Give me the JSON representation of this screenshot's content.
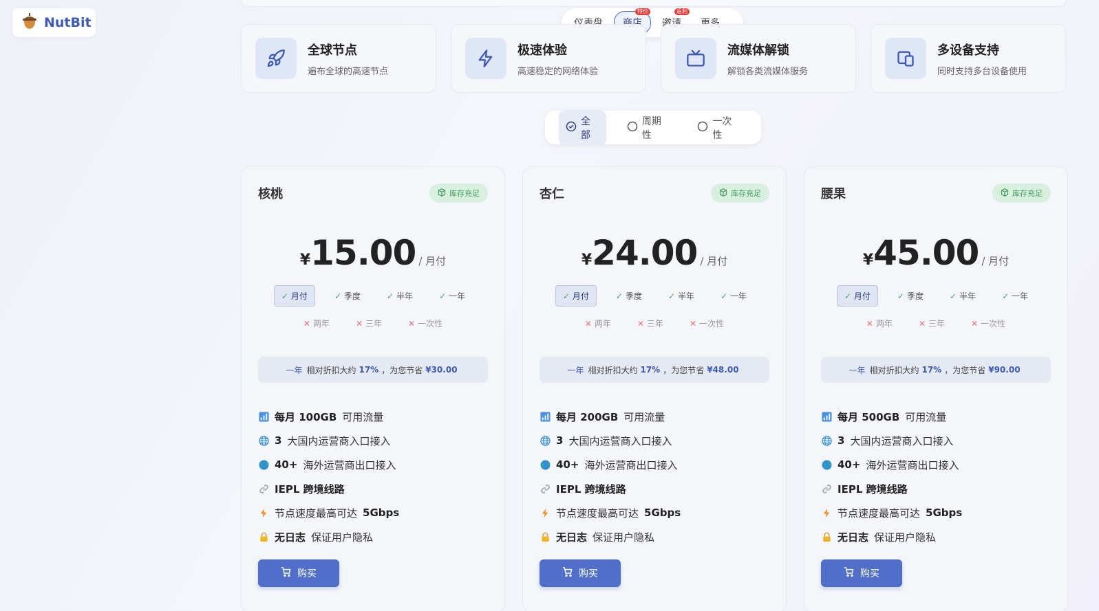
{
  "brand": {
    "name": "NutBit"
  },
  "nav": {
    "items": [
      {
        "label": "仪表盘",
        "badge": ""
      },
      {
        "label": "商店",
        "badge": "特价",
        "active": true
      },
      {
        "label": "邀请",
        "badge": "返利"
      },
      {
        "label": "更多",
        "badge": ""
      }
    ]
  },
  "features": [
    {
      "icon": "rocket-icon",
      "title": "全球节点",
      "desc": "遍布全球的高速节点"
    },
    {
      "icon": "lightning-icon",
      "title": "极速体验",
      "desc": "高速稳定的网络体验"
    },
    {
      "icon": "tv-icon",
      "title": "流媒体解锁",
      "desc": "解锁各类流媒体服务"
    },
    {
      "icon": "devices-icon",
      "title": "多设备支持",
      "desc": "同时支持多台设备使用"
    }
  ],
  "filter": {
    "items": [
      {
        "label": "全部",
        "active": true
      },
      {
        "label": "周期性",
        "active": false
      },
      {
        "label": "一次性",
        "active": false
      }
    ]
  },
  "plans": [
    {
      "name": "核桃",
      "stock": "库存充足",
      "currency": "¥",
      "price": "15.00",
      "period": "/ 月付",
      "cycles_on": [
        "月付",
        "季度",
        "半年",
        "一年"
      ],
      "cycles_off": [
        "两年",
        "三年",
        "一次性"
      ],
      "save": {
        "cycle": "一年",
        "text1": "相对折扣大约",
        "pct": "17%",
        "text2": "，为您节省",
        "amount": "¥30.00"
      },
      "features": [
        {
          "icon": "bar-chart-icon",
          "bold": "每月 100GB",
          "text": "可用流量"
        },
        {
          "icon": "globe-network-icon",
          "bold": "3",
          "text": "大国内运营商入口接入"
        },
        {
          "icon": "earth-icon",
          "bold": "40+",
          "text": "海外运营商出口接入"
        },
        {
          "icon": "link-icon",
          "bold": "IEPL 跨境线路",
          "text": ""
        },
        {
          "icon": "lightning-bolt-icon",
          "bold": "",
          "text": "节点速度最高可达",
          "tail": "5Gbps"
        },
        {
          "icon": "lock-icon",
          "bold": "无日志",
          "text": "保证用户隐私"
        }
      ],
      "buy": "购买"
    },
    {
      "name": "杏仁",
      "stock": "库存充足",
      "currency": "¥",
      "price": "24.00",
      "period": "/ 月付",
      "cycles_on": [
        "月付",
        "季度",
        "半年",
        "一年"
      ],
      "cycles_off": [
        "两年",
        "三年",
        "一次性"
      ],
      "save": {
        "cycle": "一年",
        "text1": "相对折扣大约",
        "pct": "17%",
        "text2": "，为您节省",
        "amount": "¥48.00"
      },
      "features": [
        {
          "icon": "bar-chart-icon",
          "bold": "每月 200GB",
          "text": "可用流量"
        },
        {
          "icon": "globe-network-icon",
          "bold": "3",
          "text": "大国内运营商入口接入"
        },
        {
          "icon": "earth-icon",
          "bold": "40+",
          "text": "海外运营商出口接入"
        },
        {
          "icon": "link-icon",
          "bold": "IEPL 跨境线路",
          "text": ""
        },
        {
          "icon": "lightning-bolt-icon",
          "bold": "",
          "text": "节点速度最高可达",
          "tail": "5Gbps"
        },
        {
          "icon": "lock-icon",
          "bold": "无日志",
          "text": "保证用户隐私"
        }
      ],
      "buy": "购买"
    },
    {
      "name": "腰果",
      "stock": "库存充足",
      "currency": "¥",
      "price": "45.00",
      "period": "/ 月付",
      "cycles_on": [
        "月付",
        "季度",
        "半年",
        "一年"
      ],
      "cycles_off": [
        "两年",
        "三年",
        "一次性"
      ],
      "save": {
        "cycle": "一年",
        "text1": "相对折扣大约",
        "pct": "17%",
        "text2": "，为您节省",
        "amount": "¥90.00"
      },
      "features": [
        {
          "icon": "bar-chart-icon",
          "bold": "每月 500GB",
          "text": "可用流量"
        },
        {
          "icon": "globe-network-icon",
          "bold": "3",
          "text": "大国内运营商入口接入"
        },
        {
          "icon": "earth-icon",
          "bold": "40+",
          "text": "海外运营商出口接入"
        },
        {
          "icon": "link-icon",
          "bold": "IEPL 跨境线路",
          "text": ""
        },
        {
          "icon": "lightning-bolt-icon",
          "bold": "",
          "text": "节点速度最高可达",
          "tail": "5Gbps"
        },
        {
          "icon": "lock-icon",
          "bold": "无日志",
          "text": "保证用户隐私"
        }
      ],
      "buy": "购买"
    }
  ]
}
